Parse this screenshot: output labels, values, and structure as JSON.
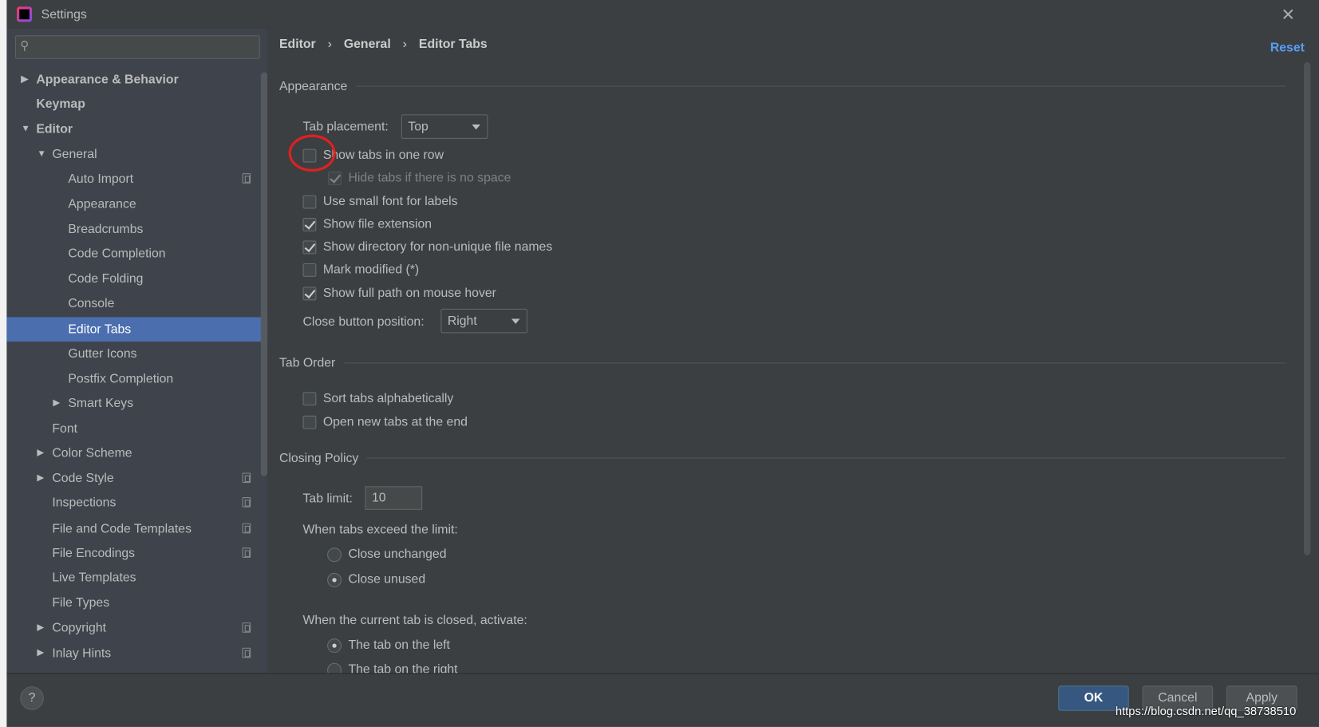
{
  "window": {
    "title": "Settings",
    "close_icon": "close-icon",
    "app_icon": "intellij-logo-icon"
  },
  "search": {
    "placeholder": "",
    "icon": "search-icon"
  },
  "sidebar": {
    "items": [
      {
        "label": "Appearance & Behavior",
        "level": 0,
        "arrow": "right",
        "bold": true
      },
      {
        "label": "Keymap",
        "level": 0,
        "bold": true
      },
      {
        "label": "Editor",
        "level": 0,
        "arrow": "down",
        "bold": true
      },
      {
        "label": "General",
        "level": 1,
        "arrow": "down"
      },
      {
        "label": "Auto Import",
        "level": 2,
        "copy": true
      },
      {
        "label": "Appearance",
        "level": 2
      },
      {
        "label": "Breadcrumbs",
        "level": 2
      },
      {
        "label": "Code Completion",
        "level": 2
      },
      {
        "label": "Code Folding",
        "level": 2
      },
      {
        "label": "Console",
        "level": 2
      },
      {
        "label": "Editor Tabs",
        "level": 2,
        "selected": true
      },
      {
        "label": "Gutter Icons",
        "level": 2
      },
      {
        "label": "Postfix Completion",
        "level": 2
      },
      {
        "label": "Smart Keys",
        "level": 2,
        "arrow": "right"
      },
      {
        "label": "Font",
        "level": 1
      },
      {
        "label": "Color Scheme",
        "level": 1,
        "arrow": "right"
      },
      {
        "label": "Code Style",
        "level": 1,
        "arrow": "right",
        "copy": true
      },
      {
        "label": "Inspections",
        "level": 1,
        "copy": true
      },
      {
        "label": "File and Code Templates",
        "level": 1,
        "copy": true
      },
      {
        "label": "File Encodings",
        "level": 1,
        "copy": true
      },
      {
        "label": "Live Templates",
        "level": 1
      },
      {
        "label": "File Types",
        "level": 1
      },
      {
        "label": "Copyright",
        "level": 1,
        "arrow": "right",
        "copy": true
      },
      {
        "label": "Inlay Hints",
        "level": 1,
        "arrow": "right",
        "copy": true
      }
    ]
  },
  "breadcrumb": [
    "Editor",
    "General",
    "Editor Tabs"
  ],
  "reset_label": "Reset",
  "appearance": {
    "title": "Appearance",
    "tab_placement_label": "Tab placement:",
    "tab_placement_value": "Top",
    "checkboxes": [
      {
        "label": "Show tabs in one row",
        "checked": false
      },
      {
        "label": "Hide tabs if there is no space",
        "checked": true,
        "disabled": true
      },
      {
        "label": "Use small font for labels",
        "checked": false
      },
      {
        "label": "Show file extension",
        "checked": true
      },
      {
        "label": "Show directory for non-unique file names",
        "checked": true
      },
      {
        "label": "Mark modified (*)",
        "checked": false
      },
      {
        "label": "Show full path on mouse hover",
        "checked": true
      }
    ],
    "close_button_label": "Close button position:",
    "close_button_value": "Right"
  },
  "tab_order": {
    "title": "Tab Order",
    "checkboxes": [
      {
        "label": "Sort tabs alphabetically",
        "checked": false
      },
      {
        "label": "Open new tabs at the end",
        "checked": false
      }
    ]
  },
  "closing_policy": {
    "title": "Closing Policy",
    "tab_limit_label": "Tab limit:",
    "tab_limit_value": "10",
    "exceed_label": "When tabs exceed the limit:",
    "exceed_options": [
      {
        "label": "Close unchanged",
        "selected": false
      },
      {
        "label": "Close unused",
        "selected": true
      }
    ],
    "activate_label": "When the current tab is closed, activate:",
    "activate_options": [
      {
        "label": "The tab on the left",
        "selected": true
      },
      {
        "label": "The tab on the right",
        "selected": false
      }
    ]
  },
  "buttons": {
    "ok": "OK",
    "cancel": "Cancel",
    "apply": "Apply",
    "help": "?"
  },
  "annotation_color": "#e02020",
  "watermark": "https://blog.csdn.net/qq_38738510"
}
